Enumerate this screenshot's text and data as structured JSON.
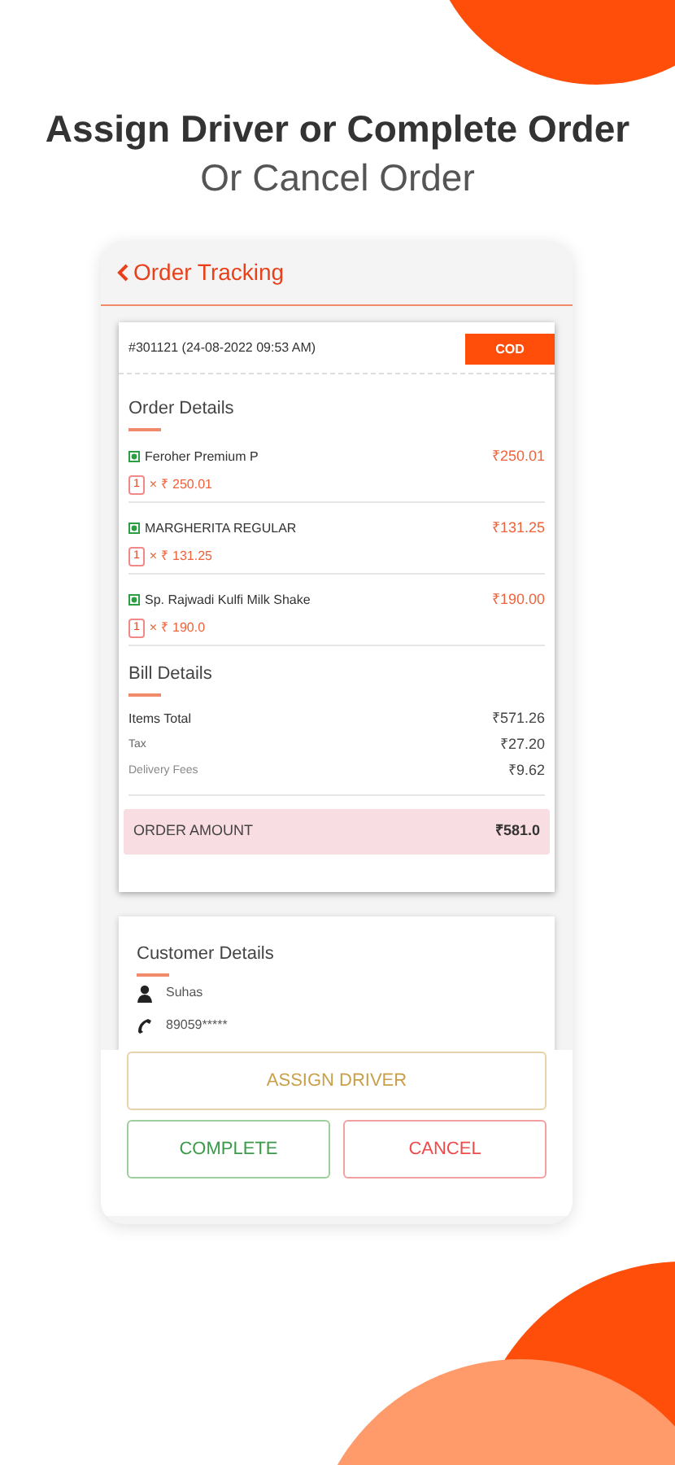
{
  "headline": "Assign Driver or Complete Order",
  "subheadline": "Or Cancel Order",
  "screen": {
    "title": "Order Tracking",
    "order": {
      "number": "#301121 (24-08-2022 09:53 AM)",
      "payment_badge": "COD",
      "section_title": "Order Details",
      "items": [
        {
          "name": "Feroher Premium P",
          "veg": true,
          "quantity": "1",
          "unit_price": "× ₹ 250.01",
          "total": "₹250.01"
        },
        {
          "name": "MARGHERITA REGULAR",
          "veg": true,
          "quantity": "1",
          "unit_price": "× ₹ 131.25",
          "total": "₹131.25"
        },
        {
          "name": "Sp. Rajwadi Kulfi Milk Shake",
          "veg": true,
          "quantity": "1",
          "unit_price": "× ₹ 190.0",
          "total": "₹190.00"
        }
      ],
      "bill_title": "Bill Details",
      "bill_rows": [
        {
          "label": "Items Total",
          "value": "₹571.26"
        },
        {
          "label": "Tax",
          "value": "₹27.20"
        },
        {
          "label": "Delivery Fees",
          "value": "₹9.62"
        }
      ],
      "amount_label": "ORDER AMOUNT",
      "amount_value": "₹581.0"
    },
    "customer": {
      "title": "Customer Details",
      "name": "Suhas",
      "phone": "89059*****"
    },
    "buttons": [
      {
        "label": "ASSIGN DRIVER",
        "kind": "assign"
      },
      {
        "label": "COMPLETE",
        "kind": "complete"
      },
      {
        "label": "CANCEL",
        "kind": "cancel"
      }
    ]
  }
}
